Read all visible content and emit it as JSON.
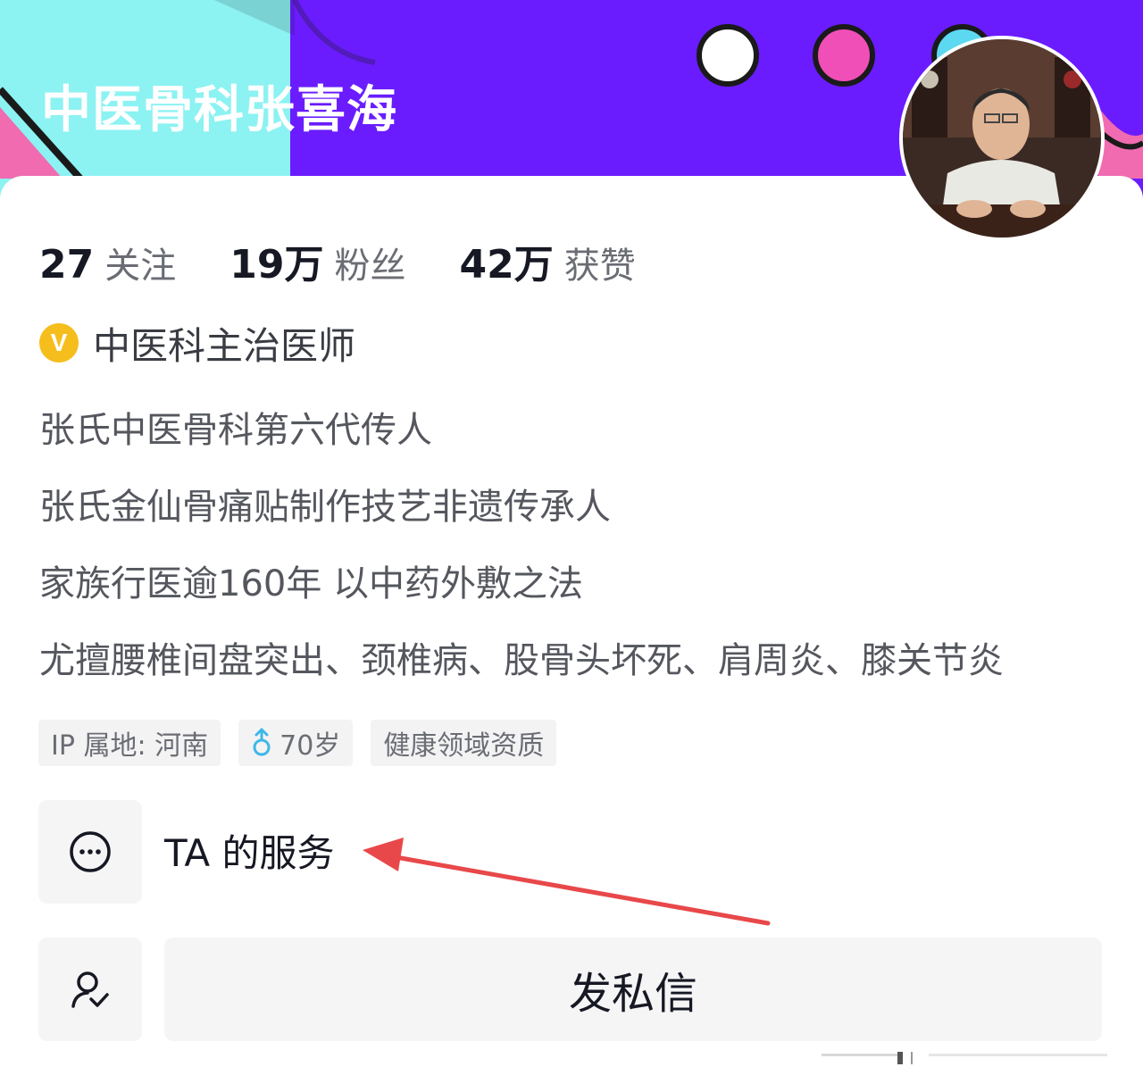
{
  "profile": {
    "display_name": "中医骨科张喜海"
  },
  "stats": [
    {
      "value": "27",
      "label": "关注"
    },
    {
      "value": "19万",
      "label": "粉丝"
    },
    {
      "value": "42万",
      "label": "获赞"
    }
  ],
  "verification": {
    "badge": "V",
    "title": "中医科主治医师"
  },
  "bio": [
    "张氏中医骨科第六代传人",
    "张氏金仙骨痛贴制作技艺非遗传承人",
    "家族行医逾160年 以中药外敷之法",
    "尤擅腰椎间盘突出、颈椎病、股骨头坏死、肩周炎、膝关节炎"
  ],
  "tags": {
    "ip_location": "IP 属地: 河南",
    "age": "70岁",
    "qualification": "健康领域资质"
  },
  "service": {
    "label": "TA 的服务"
  },
  "actions": {
    "message_label": "发私信"
  },
  "icons": {
    "service": "more-dots-icon",
    "follow": "add-friend-icon",
    "gender": "male-icon",
    "verify": "verified-badge-icon"
  },
  "colors": {
    "banner_cyan": "#8cf2f2",
    "banner_purple": "#6a1cff",
    "verify_gold": "#f6be1c",
    "gender_blue": "#3fb8e6",
    "annotation_red": "#e8484a"
  }
}
